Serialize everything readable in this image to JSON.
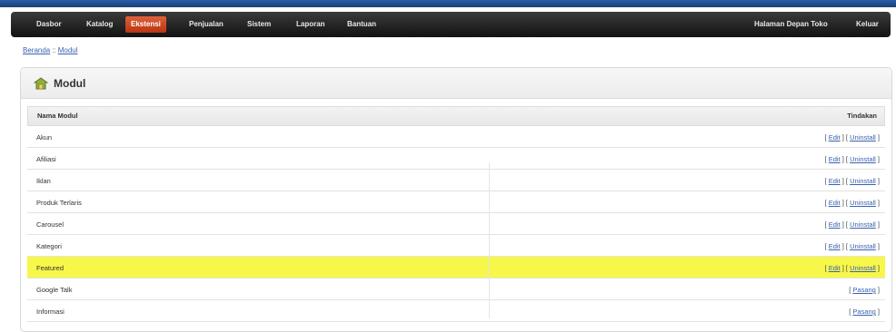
{
  "nav": {
    "items": [
      {
        "label": "Dasbor",
        "active": false
      },
      {
        "label": "Katalog",
        "active": false
      },
      {
        "label": "Ekstensi",
        "active": true
      },
      {
        "label": "Penjualan",
        "active": false
      },
      {
        "label": "Sistem",
        "active": false
      },
      {
        "label": "Laporan",
        "active": false
      },
      {
        "label": "Bantuan",
        "active": false
      }
    ],
    "storefront": "Halaman Depan Toko",
    "logout": "Keluar"
  },
  "breadcrumb": {
    "home": "Beranda",
    "separator": "::",
    "current": "Modul"
  },
  "panel": {
    "title": "Modul",
    "icon": "module-icon"
  },
  "table": {
    "col_name": "Nama Modul",
    "col_action": "Tindakan",
    "rows": [
      {
        "name": "Akun",
        "type": "installed",
        "highlight": false
      },
      {
        "name": "Afiliasi",
        "type": "installed",
        "highlight": false
      },
      {
        "name": "Iklan",
        "type": "installed",
        "highlight": false
      },
      {
        "name": "Produk Terlaris",
        "type": "installed",
        "highlight": false
      },
      {
        "name": "Carousel",
        "type": "installed",
        "highlight": false
      },
      {
        "name": "Kategori",
        "type": "installed",
        "highlight": false
      },
      {
        "name": "Featured",
        "type": "installed",
        "highlight": true
      },
      {
        "name": "Google Talk",
        "type": "available",
        "highlight": false
      },
      {
        "name": "Informasi",
        "type": "available",
        "highlight": false
      }
    ],
    "actions": {
      "edit": "Edit",
      "uninstall": "Uninstall",
      "install": "Pasang"
    }
  },
  "colors": {
    "nav_active": "#c9451f",
    "highlight": "#f7f74a",
    "link": "#3a62b0"
  }
}
